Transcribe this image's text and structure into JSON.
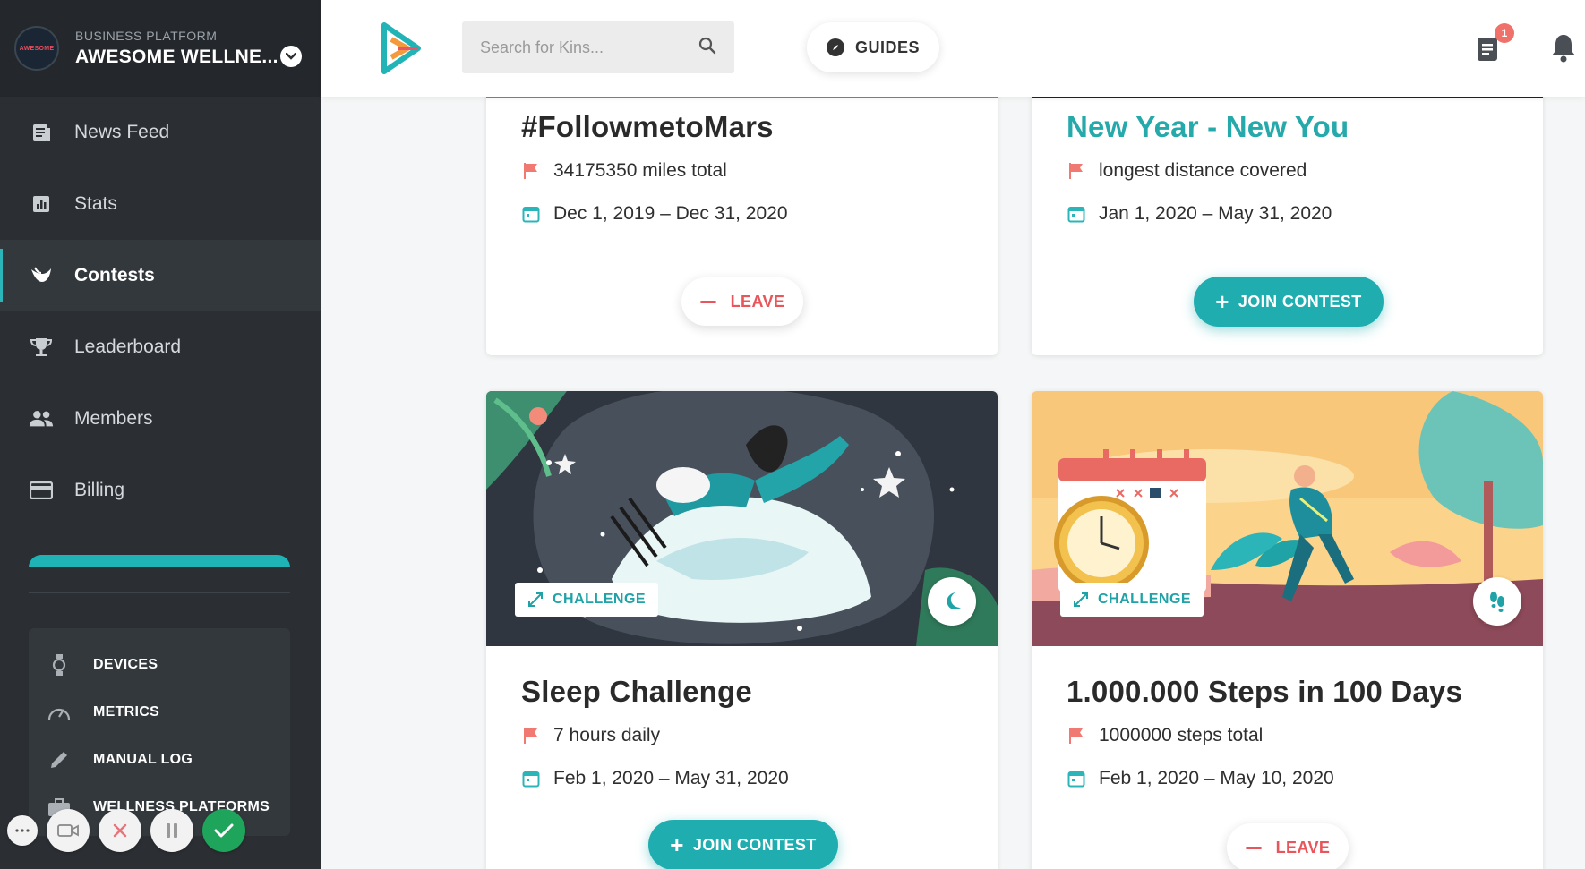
{
  "sidebar": {
    "brand": {
      "logo_text": "AWESOME",
      "subtitle": "BUSINESS PLATFORM",
      "name": "AWESOME WELLNE..."
    },
    "items": [
      {
        "label": "News Feed",
        "icon": "news-feed-icon"
      },
      {
        "label": "Stats",
        "icon": "stats-icon"
      },
      {
        "label": "Contests",
        "icon": "contests-icon",
        "active": true
      },
      {
        "label": "Leaderboard",
        "icon": "trophy-icon"
      },
      {
        "label": "Members",
        "icon": "members-icon"
      },
      {
        "label": "Billing",
        "icon": "billing-icon"
      }
    ],
    "devices": [
      {
        "label": "DEVICES",
        "icon": "watch-icon"
      },
      {
        "label": "METRICS",
        "icon": "gauge-icon"
      },
      {
        "label": "MANUAL LOG",
        "icon": "pencil-icon"
      },
      {
        "label": "WELLNESS PLATFORMS",
        "icon": "briefcase-icon"
      }
    ]
  },
  "header": {
    "search_placeholder": "Search for Kins...",
    "guides_label": "GUIDES",
    "notification_count": "1"
  },
  "cards": [
    {
      "title": "#FollowmetoMars",
      "goal": "34175350 miles total",
      "dates": "Dec 1, 2019 – Dec 31, 2020",
      "action": "LEAVE"
    },
    {
      "title": "New Year - New You",
      "goal": "longest distance covered",
      "dates": "Jan 1, 2020 – May 31, 2020",
      "action": "JOIN CONTEST"
    },
    {
      "chip": "CHALLENGE",
      "title": "Sleep Challenge",
      "goal": "7 hours daily",
      "dates": "Feb 1, 2020 – May 31, 2020",
      "action": "JOIN CONTEST"
    },
    {
      "chip": "CHALLENGE",
      "title": "1.000.000 Steps in 100 Days",
      "goal": "1000000 steps total",
      "dates": "Feb 1, 2020 – May 10, 2020",
      "action": "LEAVE"
    }
  ],
  "colors": {
    "teal": "#1fadb0",
    "leave_red": "#e8565b",
    "sidebar_bg": "#2b2f33",
    "flag": "#f07a72"
  }
}
